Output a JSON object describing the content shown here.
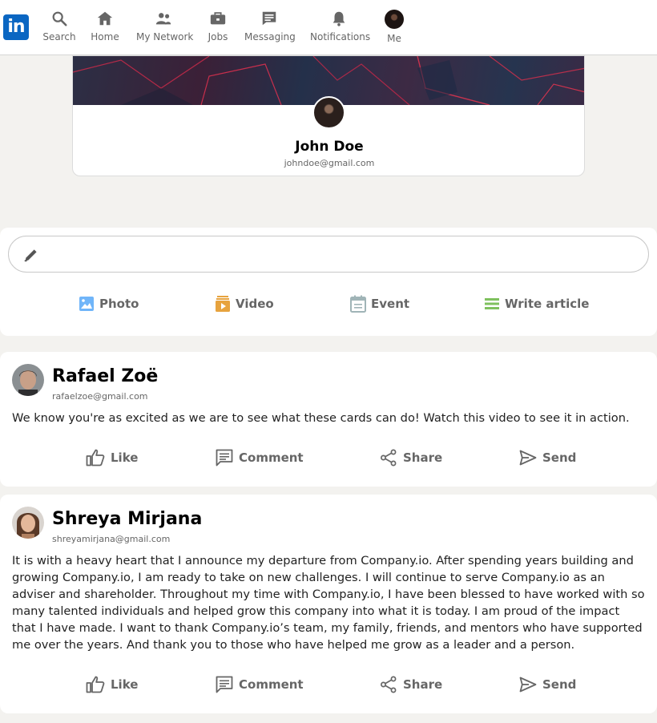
{
  "nav": {
    "logo": "in",
    "items": [
      {
        "label": "Search"
      },
      {
        "label": "Home"
      },
      {
        "label": "My Network"
      },
      {
        "label": "Jobs"
      },
      {
        "label": "Messaging"
      },
      {
        "label": "Notifications"
      },
      {
        "label": "Me"
      }
    ]
  },
  "profile": {
    "name": "John Doe",
    "email": "johndoe@gmail.com"
  },
  "create_post": {
    "placeholder": "",
    "actions": [
      {
        "label": "Photo",
        "icon": "photo-icon",
        "color": "#70b5f9"
      },
      {
        "label": "Video",
        "icon": "video-icon",
        "color": "#e7a33e"
      },
      {
        "label": "Event",
        "icon": "event-icon",
        "color": "#a0b4b7"
      },
      {
        "label": "Write article",
        "icon": "article-icon",
        "color": "#7fc15e"
      }
    ]
  },
  "posts": [
    {
      "author": "Rafael Zoë",
      "email": "rafaelzoe@gmail.com",
      "text": "We know you're as excited as we are to see what these cards can do! Watch this video to see it in action."
    },
    {
      "author": "Shreya Mirjana",
      "email": "shreyamirjana@gmail.com",
      "text": "It is with a heavy heart that I announce my departure from Company.io. After spending years building and growing Company.io, I am ready to take on new challenges. I will continue to serve Company.io as an adviser and shareholder. Throughout my time with Company.io, I have been blessed to have worked with so many talented individuals and helped grow this company into what it is today. I am proud of the impact that I have made. I want to thank Company.io’s team, my family, friends, and mentors who have supported me over the years. And thank you to those who have helped me grow as a leader and a person."
    }
  ],
  "post_actions": {
    "like": "Like",
    "comment": "Comment",
    "share": "Share",
    "send": "Send"
  },
  "colors": {
    "brand": "#0a66c2",
    "page_bg": "#f3f2ef",
    "muted_text": "#666666"
  }
}
